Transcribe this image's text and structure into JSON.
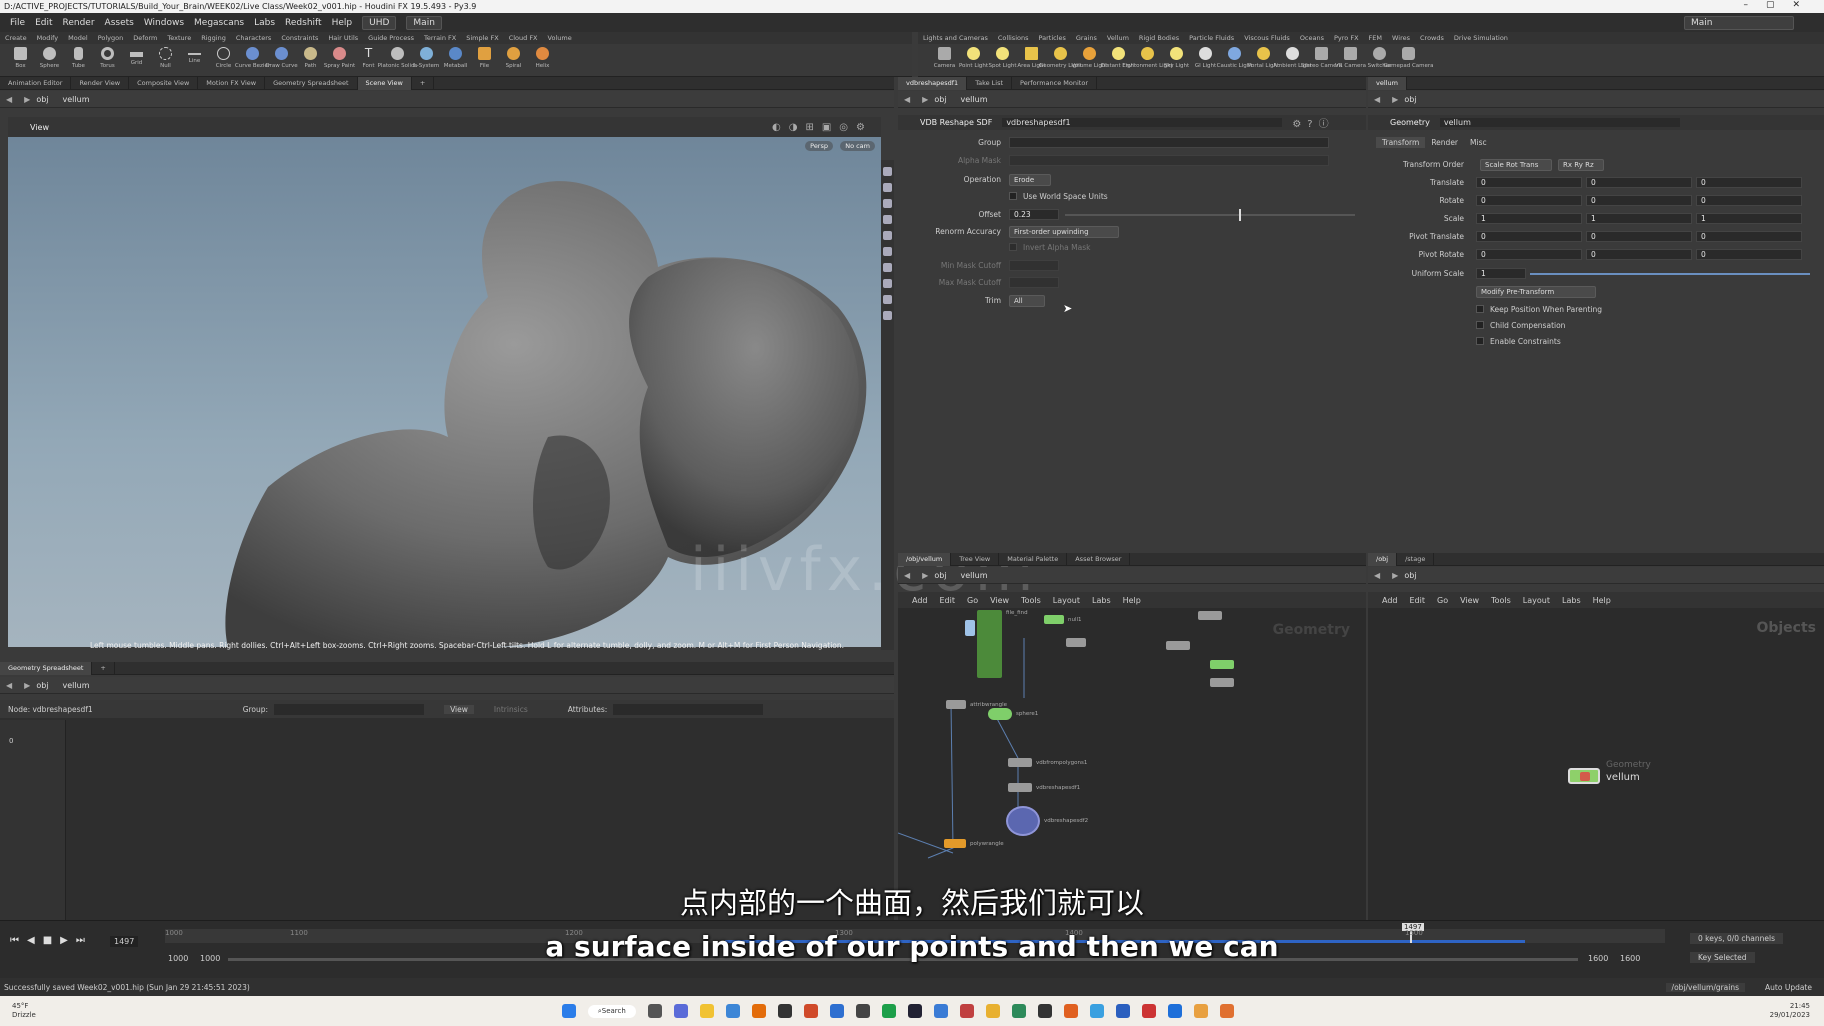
{
  "window": {
    "title": "D:/ACTIVE_PROJECTS/TUTORIALS/Build_Your_Brain/WEEK02/Live Class/Week02_v001.hip - Houdini FX 19.5.493 - Py3.9"
  },
  "menu": {
    "items": [
      "File",
      "Edit",
      "Render",
      "Assets",
      "Windows",
      "Megascans",
      "Labs",
      "Redshift",
      "Help"
    ],
    "uhd": "UHD",
    "desktop": "Main",
    "desktop_right": "Main"
  },
  "shelf_left": {
    "tabs": [
      "Create",
      "Modify",
      "Model",
      "Polygon",
      "Deform",
      "Texture",
      "Rigging",
      "Characters",
      "Constraints",
      "Hair Utils",
      "Guide Process",
      "Terrain FX",
      "Simple FX",
      "Cloud FX",
      "Volume"
    ],
    "tools": [
      "Box",
      "Sphere",
      "Tube",
      "Torus",
      "Grid",
      "Null",
      "Line",
      "Circle",
      "Curve Bezier",
      "Draw Curve",
      "Path",
      "Spray Paint",
      "Font",
      "Platonic Solids",
      "L-System",
      "Metaball",
      "File",
      "Spiral",
      "Helix"
    ]
  },
  "shelf_right": {
    "tabs": [
      "Lights and Cameras",
      "Collisions",
      "Particles",
      "Grains",
      "Vellum",
      "Rigid Bodies",
      "Particle Fluids",
      "Viscous Fluids",
      "Oceans",
      "Pyro FX",
      "FEM",
      "Wires",
      "Crowds",
      "Drive Simulation"
    ],
    "tools": [
      "Camera",
      "Point Light",
      "Spot Light",
      "Area Light",
      "Geometry Light",
      "Volume Light",
      "Distant Light",
      "Environment Light",
      "Sky Light",
      "GI Light",
      "Caustic Light",
      "Portal Light",
      "Ambient Light",
      "Stereo Camera",
      "VR Camera",
      "Switcher",
      "Gamepad Camera"
    ]
  },
  "viewer": {
    "tabs": [
      "Animation Editor",
      "Render View",
      "Composite View",
      "Motion FX View",
      "Geometry Spreadsheet",
      "Scene View"
    ],
    "path": [
      "obj",
      "vellum"
    ],
    "view_label": "View",
    "persp": "Persp",
    "cam": "No cam",
    "help_text": "Left mouse tumbles. Middle pans. Right dollies. Ctrl+Alt+Left box-zooms. Ctrl+Right zooms. Spacebar-Ctrl-Left tilts. Hold L for alternate tumble, dolly, and zoom.    M or Alt+M for First Person Navigation."
  },
  "params": {
    "tabs": [
      "vdbreshapesdf1",
      "Take List",
      "Performance Monitor"
    ],
    "path": [
      "obj",
      "vellum"
    ],
    "node_type": "VDB Reshape SDF",
    "node_name": "vdbreshapesdf1",
    "fields": {
      "group_label": "Group",
      "alpha_mask_label": "Alpha Mask",
      "operation_label": "Operation",
      "operation_value": "Erode",
      "world_units_label": "Use World Space Units",
      "offset_label": "Offset",
      "offset_value": "0.23",
      "offset_fraction": 0.6,
      "renorm_label": "Renorm Accuracy",
      "renorm_value": "First-order upwinding",
      "invert_label": "Invert Alpha Mask",
      "min_cutoff_label": "Min Mask Cutoff",
      "max_cutoff_label": "Max Mask Cutoff",
      "trim_label": "Trim",
      "trim_value": "All"
    }
  },
  "geometry": {
    "tabs": [
      "vellum"
    ],
    "path": [
      "obj"
    ],
    "node_type": "Geometry",
    "node_name": "vellum",
    "subtabs": [
      "Transform",
      "Render",
      "Misc"
    ],
    "transform_order_label": "Transform Order",
    "transform_order_value": "Scale Rot Trans",
    "rot_order_value": "Rx Ry Rz",
    "rows": [
      {
        "label": "Translate",
        "v": [
          "0",
          "0",
          "0"
        ]
      },
      {
        "label": "Rotate",
        "v": [
          "0",
          "0",
          "0"
        ]
      },
      {
        "label": "Scale",
        "v": [
          "1",
          "1",
          "1"
        ]
      },
      {
        "label": "Pivot Translate",
        "v": [
          "0",
          "0",
          "0"
        ]
      },
      {
        "label": "Pivot Rotate",
        "v": [
          "0",
          "0",
          "0"
        ]
      }
    ],
    "uniform_scale_label": "Uniform Scale",
    "uniform_scale_value": "1",
    "modify_pre": "Modify Pre-Transform",
    "checks": [
      "Keep Position When Parenting",
      "Child Compensation",
      "Enable Constraints"
    ]
  },
  "spreadsheet": {
    "tabs": [
      "Geometry Spreadsheet"
    ],
    "path": [
      "obj",
      "vellum"
    ],
    "node_label": "Node: vdbreshapesdf1",
    "group_label": "Group:",
    "view_label": "View",
    "intrinsics_label": "Intrinsics",
    "attributes_label": "Attributes:",
    "row0": "0"
  },
  "network": {
    "tabs": [
      "/obj/vellum",
      "Tree View",
      "Material Palette",
      "Asset Browser"
    ],
    "path": [
      "obj",
      "vellum"
    ],
    "menu": [
      "Add",
      "Edit",
      "Go",
      "View",
      "Tools",
      "Layout",
      "Labs",
      "Help"
    ],
    "watermark": "Geometry",
    "nodes": [
      "file_find",
      "attribwrangle",
      "null1",
      "sphere1",
      "vdbfrompolygons1",
      "vdbreshapesdf1",
      "vdbreshapesdf2",
      "polywrangle"
    ]
  },
  "obj_net": {
    "tabs": [
      "/obj",
      "/stage"
    ],
    "path": [
      "obj"
    ],
    "menu": [
      "Add",
      "Edit",
      "Go",
      "View",
      "Tools",
      "Layout",
      "Labs",
      "Help"
    ],
    "watermark": "Objects",
    "node_type": "Geometry",
    "node_name": "vellum"
  },
  "timeline": {
    "frame": "1497",
    "ticks": [
      "1000",
      "1100",
      "1200",
      "1300",
      "1400",
      "1500"
    ],
    "range_start": "1000",
    "range_start2": "1000",
    "range_end": "1600",
    "range_end2": "1600",
    "marker": "1497",
    "keys": "0 keys, 0/0 channels",
    "key_selected": "Key Selected",
    "playhead_fraction": 0.83
  },
  "status": {
    "message": "Successfully saved Week02_v001.hip (Sun Jan 29 21:45:51 2023)",
    "path": "/obj/vellum/grains",
    "auto_update": "Auto Update"
  },
  "taskbar": {
    "weather": "45°F",
    "weather_sub": "Drizzle",
    "search": "Search",
    "time": "21:45",
    "date": "29/01/2023"
  },
  "subtitle": {
    "cn": "点内部的一个曲面，然后我们就可以",
    "en": "a surface inside of our points and then we can"
  },
  "watermark": "iiivfx.com"
}
